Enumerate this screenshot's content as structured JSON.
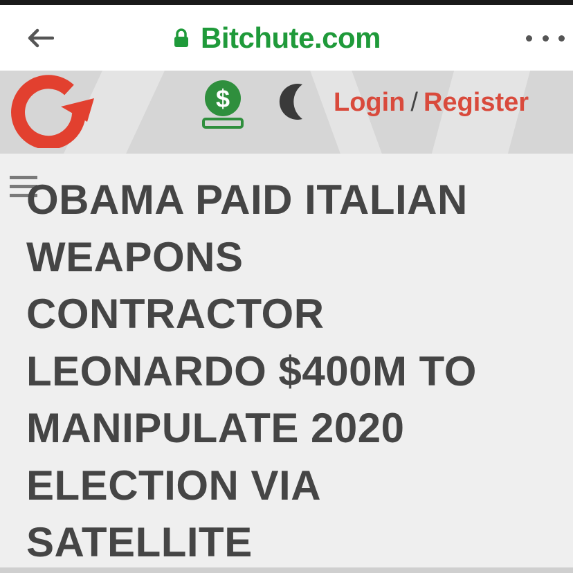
{
  "browser": {
    "url": "Bitchute.com"
  },
  "site_header": {
    "login_label": "Login",
    "separator": "/",
    "register_label": "Register"
  },
  "article": {
    "headline_lines": [
      "OBAMA PAID ITALIAN",
      "WEAPONS",
      "CONTRACTOR",
      "LEONARDO $400M TO",
      "MANIPULATE 2020",
      "ELECTION VIA",
      "SATELLITE"
    ]
  },
  "colors": {
    "url_green": "#1f9a3a",
    "brand_red": "#d94a3c",
    "headline_gray": "#454545",
    "header_bg": "#d6d6d6"
  },
  "icons": [
    "back-arrow-icon",
    "lock-icon",
    "more-options-icon",
    "bitchute-logo",
    "dollar-donate-icon",
    "moon-icon",
    "hamburger-menu-icon"
  ]
}
